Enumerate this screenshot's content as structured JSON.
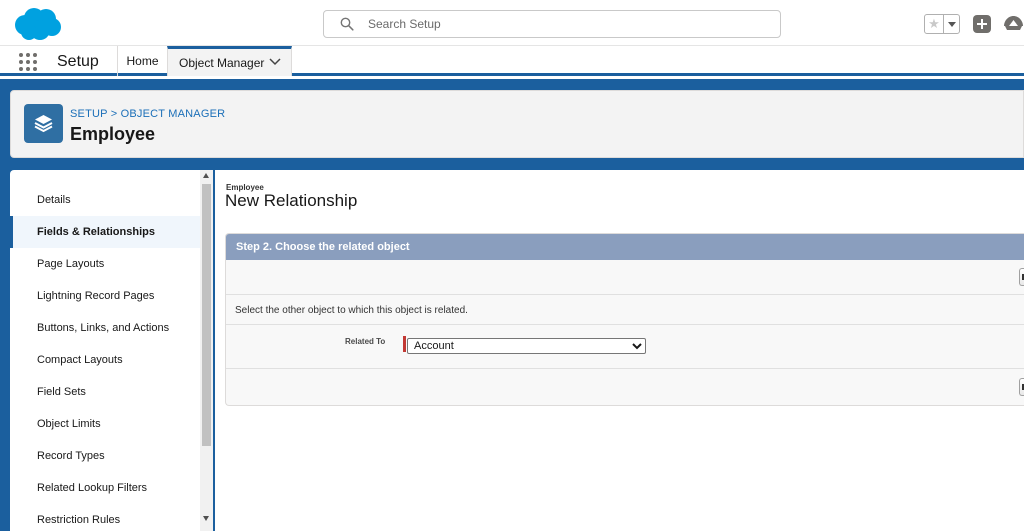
{
  "header": {
    "search_placeholder": "Search Setup",
    "icons": {
      "logo": "salesforce-cloud-logo",
      "search": "search-icon",
      "favorite": "star-icon",
      "favorites_dropdown": "caret-down-icon",
      "global_actions": "plus-icon",
      "trailhead": "trailhead-icon"
    }
  },
  "nav": {
    "app_launcher_icon": "waffle-icon",
    "app_name": "Setup",
    "tabs": [
      {
        "label": "Home"
      },
      {
        "label": "Object Manager",
        "active": true
      }
    ]
  },
  "object_header": {
    "breadcrumb": "SETUP > OBJECT MANAGER",
    "title": "Employee",
    "icon": "layers-icon"
  },
  "sidebar": {
    "items": [
      {
        "label": "Details"
      },
      {
        "label": "Fields & Relationships",
        "active": true
      },
      {
        "label": "Page Layouts"
      },
      {
        "label": "Lightning Record Pages"
      },
      {
        "label": "Buttons, Links, and Actions"
      },
      {
        "label": "Compact Layouts"
      },
      {
        "label": "Field Sets"
      },
      {
        "label": "Object Limits"
      },
      {
        "label": "Record Types"
      },
      {
        "label": "Related Lookup Filters"
      },
      {
        "label": "Restriction Rules"
      }
    ]
  },
  "main": {
    "object_label": "Employee",
    "page_title": "New Relationship",
    "step_title": "Step 2. Choose the related object",
    "description": "Select the other object to which this object is related.",
    "related_to_label": "Related To",
    "related_to_value": "Account"
  },
  "colors": {
    "brand_blue": "#1b5f9e",
    "step_header": "#8a9ebe",
    "required": "#c23934",
    "link": "#1b6fb8"
  }
}
